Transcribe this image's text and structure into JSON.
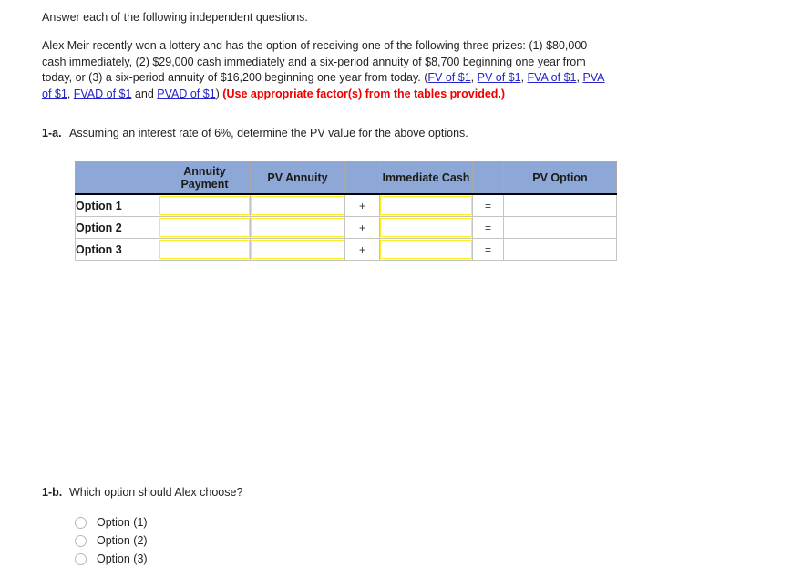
{
  "intro": {
    "text": "Answer each of the following independent questions."
  },
  "prompt": {
    "part1": "Alex Meir recently won a lottery and has the option of receiving one of the following three prizes: (1) $80,000 cash immediately, (2) $29,000 cash immediately and a six-period annuity of $8,700 beginning one year from today, or (3) a six-period annuity of $16,200 beginning one year from today. (",
    "links": [
      "FV of $1",
      "PV of $1",
      "FVA of $1",
      "PVA of $1",
      "FVAD of $1",
      "PVAD of $1"
    ],
    "sep_comma": ", ",
    "sep_and": " and ",
    "close_paren": ") ",
    "note": "(Use appropriate factor(s) from the tables provided.)",
    "link_color": "#2424c8",
    "note_color": "#ee0000"
  },
  "questions": {
    "a": {
      "number": "1-a.",
      "text": "Assuming an interest rate of 6%, determine the PV value for the above options."
    },
    "b": {
      "number": "1-b.",
      "text": "Which option should Alex choose?"
    }
  },
  "table": {
    "headers": [
      "",
      "Annuity Payment",
      "PV Annuity",
      "",
      "Immediate Cash",
      "",
      "PV Option"
    ],
    "header_bg": "#8da8d6",
    "input_border": "#ffee22",
    "result_bg": "#ffffaa",
    "rows": [
      {
        "label": "Option 1",
        "annuity_payment": "",
        "pv_annuity": "",
        "plus": "+",
        "immediate_cash": "",
        "equals": "=",
        "pv_option": ""
      },
      {
        "label": "Option 2",
        "annuity_payment": "",
        "pv_annuity": "",
        "plus": "+",
        "immediate_cash": "",
        "equals": "=",
        "pv_option": ""
      },
      {
        "label": "Option 3",
        "annuity_payment": "",
        "pv_annuity": "",
        "plus": "+",
        "immediate_cash": "",
        "equals": "=",
        "pv_option": ""
      }
    ]
  },
  "choices": {
    "options": [
      {
        "label": "Option (1)",
        "selected": false
      },
      {
        "label": "Option (2)",
        "selected": false
      },
      {
        "label": "Option (3)",
        "selected": false
      }
    ]
  }
}
